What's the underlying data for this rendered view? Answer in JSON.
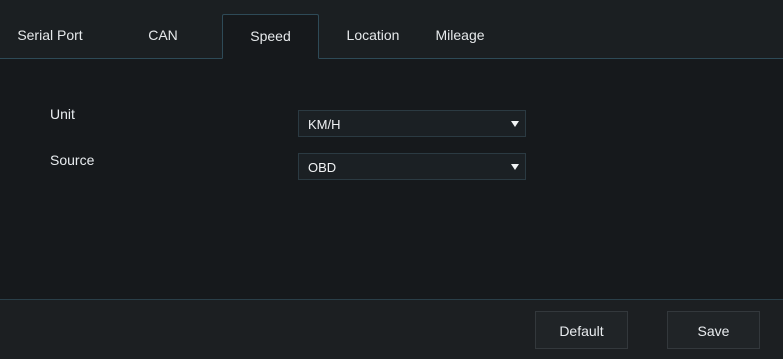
{
  "tabs": [
    {
      "label": "Serial Port"
    },
    {
      "label": "CAN"
    },
    {
      "label": "Speed",
      "active": true
    },
    {
      "label": "Location"
    },
    {
      "label": "Mileage"
    }
  ],
  "form": {
    "unit": {
      "label": "Unit",
      "value": "KM/H"
    },
    "source": {
      "label": "Source",
      "value": "OBD"
    }
  },
  "footer": {
    "default_label": "Default",
    "save_label": "Save"
  },
  "colors": {
    "background": "#16191c",
    "tab_border": "#2e4a57",
    "text": "#e8ecef"
  }
}
